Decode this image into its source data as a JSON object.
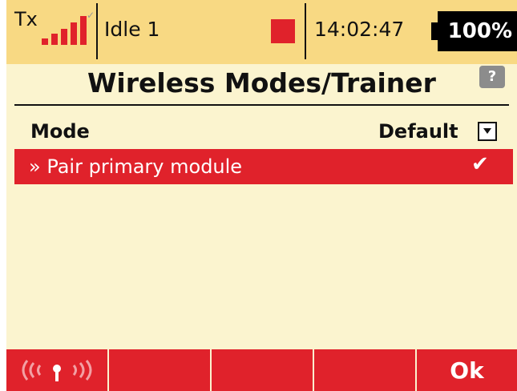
{
  "status_bar": {
    "tx_label": "Tx",
    "model_name": "Idle 1",
    "clock": "14:02:47",
    "battery": "100%",
    "signal_bars": 5
  },
  "page": {
    "title": "Wireless Modes/Trainer"
  },
  "header_row": {
    "mode_label": "Mode",
    "default_label": "Default"
  },
  "list": {
    "items": [
      {
        "label": "» Pair primary module",
        "checked": true
      }
    ]
  },
  "softkeys": [
    {
      "label": "((·♦·))",
      "icon": "wireless-icon"
    },
    {
      "label": ""
    },
    {
      "label": ""
    },
    {
      "label": ""
    },
    {
      "label": "Ok"
    }
  ],
  "colors": {
    "accent_red": "#e0222b",
    "status_bar": "#f8d983",
    "background": "#fbf4cf"
  }
}
